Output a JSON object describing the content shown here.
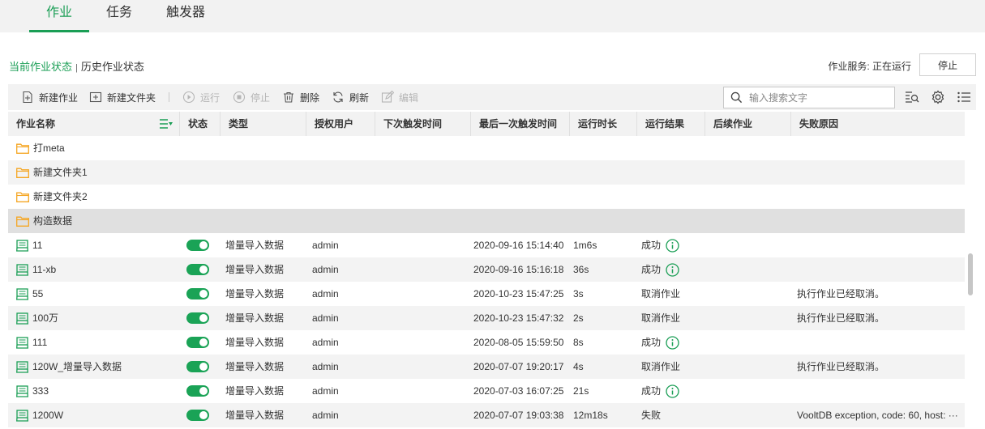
{
  "tabs": [
    "作业",
    "任务",
    "触发器"
  ],
  "view_toggle": {
    "current": "当前作业状态",
    "separator": "|",
    "history": "历史作业状态"
  },
  "service": {
    "label": "作业服务: 正在运行",
    "stop_button": "停止"
  },
  "toolbar": {
    "new_job": "新建作业",
    "new_folder": "新建文件夹",
    "run": "运行",
    "stop": "停止",
    "delete": "删除",
    "refresh": "刷新",
    "edit": "编辑"
  },
  "search": {
    "placeholder": "输入搜索文字"
  },
  "columns": [
    "作业名称",
    "状态",
    "类型",
    "授权用户",
    "下次触发时间",
    "最后一次触发时间",
    "运行时长",
    "运行结果",
    "后续作业",
    "失败原因"
  ],
  "folders": [
    {
      "name": "打meta"
    },
    {
      "name": "新建文件夹1"
    },
    {
      "name": "新建文件夹2"
    },
    {
      "name": "构造数据"
    }
  ],
  "jobs": [
    {
      "name": "11",
      "type": "增量导入数据",
      "user": "admin",
      "next": "",
      "last": "2020-09-16 15:14:40",
      "duration": "1m6s",
      "result": "成功",
      "info": true,
      "reason": ""
    },
    {
      "name": "11-xb",
      "type": "增量导入数据",
      "user": "admin",
      "next": "",
      "last": "2020-09-16 15:16:18",
      "duration": "36s",
      "result": "成功",
      "info": true,
      "reason": ""
    },
    {
      "name": "55",
      "type": "增量导入数据",
      "user": "admin",
      "next": "",
      "last": "2020-10-23 15:47:25",
      "duration": "3s",
      "result": "取消作业",
      "info": false,
      "reason": "执行作业已经取消。"
    },
    {
      "name": "100万",
      "type": "增量导入数据",
      "user": "admin",
      "next": "",
      "last": "2020-10-23 15:47:32",
      "duration": "2s",
      "result": "取消作业",
      "info": false,
      "reason": "执行作业已经取消。"
    },
    {
      "name": "111",
      "type": "增量导入数据",
      "user": "admin",
      "next": "",
      "last": "2020-08-05 15:59:50",
      "duration": "8s",
      "result": "成功",
      "info": true,
      "reason": ""
    },
    {
      "name": "120W_增量导入数据",
      "type": "增量导入数据",
      "user": "admin",
      "next": "",
      "last": "2020-07-07 19:20:17",
      "duration": "4s",
      "result": "取消作业",
      "info": false,
      "reason": "执行作业已经取消。"
    },
    {
      "name": "333",
      "type": "增量导入数据",
      "user": "admin",
      "next": "",
      "last": "2020-07-03 16:07:25",
      "duration": "21s",
      "result": "成功",
      "info": true,
      "reason": ""
    },
    {
      "name": "1200W",
      "type": "增量导入数据",
      "user": "admin",
      "next": "",
      "last": "2020-07-07 19:03:38",
      "duration": "12m18s",
      "result": "失败",
      "info": false,
      "reason": "VooltDB exception, code: 60, host: ···"
    }
  ],
  "colors": {
    "accent": "#1a9e55",
    "folder": "#f5a623",
    "toggle": "#1aa356"
  }
}
